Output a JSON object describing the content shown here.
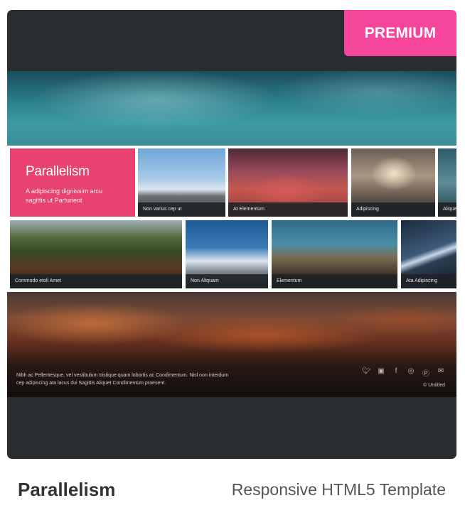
{
  "badge": {
    "label": "PREMIUM",
    "color": "#f5469c"
  },
  "preview": {
    "pink_tile": {
      "title": "Parallelism",
      "subtitle": "A adipiscing dignissim arcu sagittis ut Parturient"
    },
    "row1_captions": [
      "Non varius cep ut",
      "At Elementum",
      "Adipiscing",
      "Aliquet"
    ],
    "row2_captions": [
      "Commodo etoli Amet",
      "Non Aliquam",
      "Elementum",
      "Ata Adipiscing"
    ],
    "footer": {
      "line1": "Nibh ac Pellentesque, vel vestibulum tristique quam lobortis ac Condimentum. Nisl non interdum",
      "line2": "cep adipiscing ata lacus dui Sagittis Aliquet Condimentum praesent.",
      "social_icons": [
        "twitter-icon",
        "instagram-icon",
        "facebook-icon",
        "dribbble-icon",
        "pinterest-icon",
        "mail-icon"
      ],
      "copyright": "© Untitled"
    }
  },
  "product": {
    "name": "Parallelism",
    "description": "Responsive HTML5 Template"
  }
}
